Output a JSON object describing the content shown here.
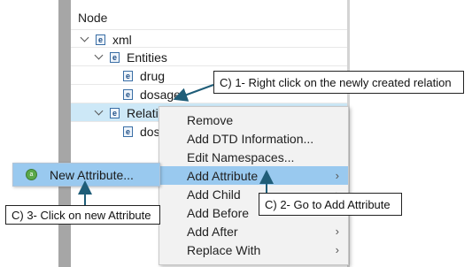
{
  "tree": {
    "header": "Node",
    "nodes": [
      {
        "label": "xml",
        "icon": "e"
      },
      {
        "label": "Entities",
        "icon": "e"
      },
      {
        "label": "drug",
        "icon": "e"
      },
      {
        "label": "dosage",
        "icon": "e"
      },
      {
        "label": "Relatio",
        "icon": "e"
      },
      {
        "label": "dosa",
        "icon": "e"
      }
    ],
    "selected_node": "Relatio"
  },
  "context_menu": {
    "items": [
      {
        "label": "Remove",
        "has_submenu": false
      },
      {
        "label": "Add DTD Information...",
        "has_submenu": false
      },
      {
        "label": "Edit Namespaces...",
        "has_submenu": false
      },
      {
        "label": "Add Attribute",
        "has_submenu": true,
        "highlighted": true
      },
      {
        "label": "Add Child",
        "has_submenu": true
      },
      {
        "label": "Add Before",
        "has_submenu": true
      },
      {
        "label": "Add After",
        "has_submenu": true
      },
      {
        "label": "Replace With",
        "has_submenu": true
      }
    ],
    "submenu_arrow": "›"
  },
  "submenu": {
    "item_label": "New Attribute...",
    "item_icon": "a"
  },
  "callouts": {
    "step1": "C) 1- Right click on the newly created relation",
    "step2": "C) 2- Go to Add Attribute",
    "step3": "C) 3- Click on new Attribute"
  },
  "colors": {
    "highlight": "#99c9ef",
    "selected_row": "#cde8f7",
    "callout_arrow": "#1f5d78"
  }
}
